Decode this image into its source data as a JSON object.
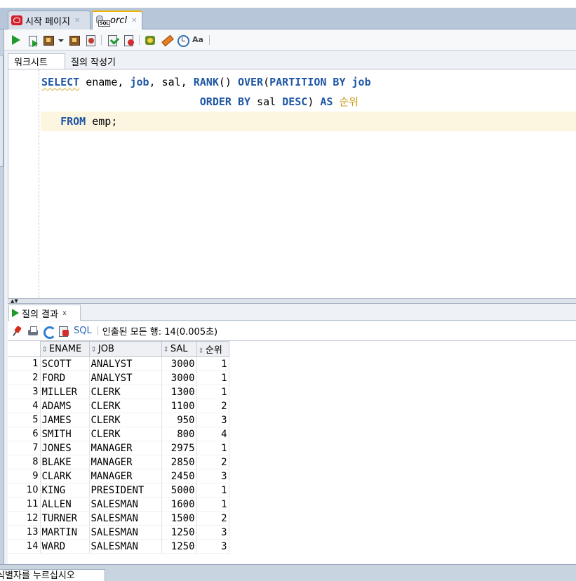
{
  "tabs": [
    {
      "label": "시작 페이지",
      "active": false,
      "icon": "oracle-icon"
    },
    {
      "label": "orcl",
      "active": true,
      "icon": "sql-worksheet-icon"
    }
  ],
  "editor_tabs": [
    "워크시트",
    "질의 작성기"
  ],
  "code": {
    "line1": {
      "kw1": "SELECT",
      "t1": " ename, ",
      "kw2": "job",
      "t2": ", sal, ",
      "kw3": "RANK",
      "t3": "() ",
      "kw4": "OVER",
      "t4": "(",
      "kw5": "PARTITION BY",
      "t5": " ",
      "kw6": "job"
    },
    "line2": {
      "indent": "                         ",
      "kw1": "ORDER BY",
      "t1": " sal ",
      "kw2": "DESC",
      "t2": ") ",
      "kw3": "AS",
      "t3": " ",
      "alias": "순위"
    },
    "line3": {
      "indent": "   ",
      "kw1": "FROM",
      "t1": " emp;"
    }
  },
  "results": {
    "tab_label": "질의 결과",
    "tab_close": "x",
    "sql_link": "SQL",
    "status": "인출된 모든 행: 14(0.005초)",
    "columns": [
      "ENAME",
      "JOB",
      "SAL",
      "순위"
    ],
    "rows": [
      [
        "1",
        "SCOTT",
        "ANALYST",
        "3000",
        "1"
      ],
      [
        "2",
        "FORD",
        "ANALYST",
        "3000",
        "1"
      ],
      [
        "3",
        "MILLER",
        "CLERK",
        "1300",
        "1"
      ],
      [
        "4",
        "ADAMS",
        "CLERK",
        "1100",
        "2"
      ],
      [
        "5",
        "JAMES",
        "CLERK",
        "950",
        "3"
      ],
      [
        "6",
        "SMITH",
        "CLERK",
        "800",
        "4"
      ],
      [
        "7",
        "JONES",
        "MANAGER",
        "2975",
        "1"
      ],
      [
        "8",
        "BLAKE",
        "MANAGER",
        "2850",
        "2"
      ],
      [
        "9",
        "CLARK",
        "MANAGER",
        "2450",
        "3"
      ],
      [
        "10",
        "KING",
        "PRESIDENT",
        "5000",
        "1"
      ],
      [
        "11",
        "ALLEN",
        "SALESMAN",
        "1600",
        "1"
      ],
      [
        "12",
        "TURNER",
        "SALESMAN",
        "1500",
        "2"
      ],
      [
        "13",
        "MARTIN",
        "SALESMAN",
        "1250",
        "3"
      ],
      [
        "14",
        "WARD",
        "SALESMAN",
        "1250",
        "3"
      ]
    ]
  },
  "bottom_tab": "식별자를 누르십시오",
  "toolbar_icons": [
    "run-statement-icon",
    "run-script-icon",
    "autotrace-icon",
    "dropdown-icon",
    "explain-plan-icon",
    "sql-tuning-icon",
    "commit-icon",
    "rollback-icon",
    "unshared-sql-icon",
    "clear-icon",
    "sql-history-icon",
    "format-icon"
  ],
  "colors": {
    "keyword": "#1f56a4",
    "alias": "#c99a12",
    "current_line": "#fcf6e1",
    "run": "#1f9a2a"
  }
}
